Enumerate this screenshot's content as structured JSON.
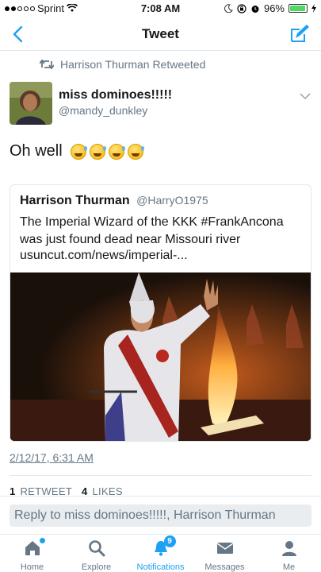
{
  "status_bar": {
    "carrier": "Sprint",
    "time": "7:08 AM",
    "battery": "96%",
    "battery_level": 0.96
  },
  "nav": {
    "title": "Tweet"
  },
  "retweet_header": {
    "text": "Harrison Thurman Retweeted"
  },
  "tweet": {
    "author_name": "miss dominoes!!!!!",
    "author_handle": "@mandy_dunkley",
    "text": "Oh well",
    "emoji_count": 4,
    "timestamp": "2/12/17, 6:31 AM"
  },
  "quoted_tweet": {
    "name": "Harrison Thurman",
    "handle": "@HarryO1975",
    "text": "The Imperial Wizard of the KKK #FrankAncona was just found dead near Missouri river",
    "link": "usuncut.com/news/imperial-..."
  },
  "stats": {
    "retweets_count": "1",
    "retweets_label": "RETWEET",
    "likes_count": "4",
    "likes_label": "LIKES"
  },
  "reply": {
    "placeholder": "Reply to miss dominoes!!!!!, Harrison Thurman"
  },
  "tabs": [
    {
      "label": "Home",
      "icon": "home-icon"
    },
    {
      "label": "Explore",
      "icon": "search-icon"
    },
    {
      "label": "Notifications",
      "icon": "bell-icon",
      "badge": "9"
    },
    {
      "label": "Messages",
      "icon": "envelope-icon"
    },
    {
      "label": "Me",
      "icon": "person-icon"
    }
  ],
  "colors": {
    "accent": "#1da1f2",
    "secondary_text": "#657786",
    "divider": "#e1e8ed"
  }
}
